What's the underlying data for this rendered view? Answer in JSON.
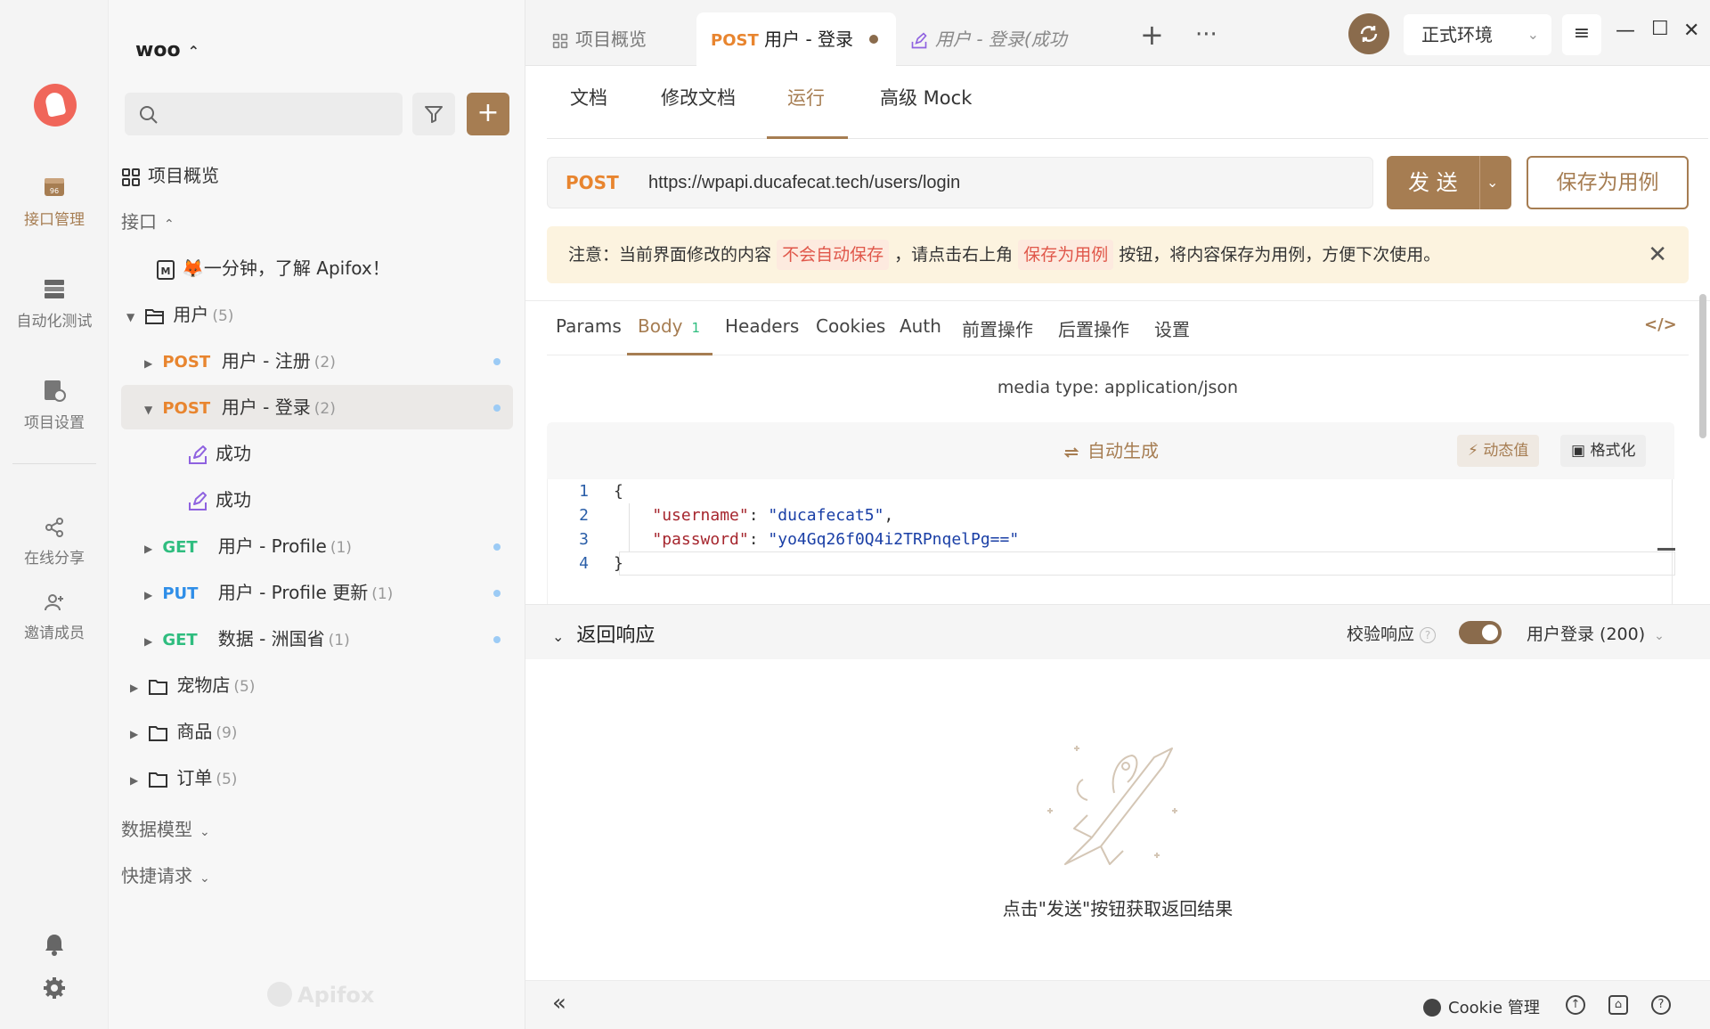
{
  "rail": {
    "items": [
      {
        "label": "接口管理",
        "icon": "api-icon",
        "active": true
      },
      {
        "label": "自动化测试",
        "icon": "test-icon",
        "active": false
      },
      {
        "label": "项目设置",
        "icon": "settings-doc-icon",
        "active": false
      },
      {
        "label": "在线分享",
        "icon": "share-icon",
        "active": false
      },
      {
        "label": "邀请成员",
        "icon": "invite-icon",
        "active": false
      }
    ]
  },
  "sidebar": {
    "project_name": "woo",
    "search_placeholder": "",
    "overview": "项目概览",
    "api_section": "接口",
    "intro": "🦊一分钟，了解 Apifox！",
    "folder_user": {
      "name": "用户",
      "count": "(5)"
    },
    "items": [
      {
        "method": "POST",
        "name": "用户 - 注册",
        "count": "(2)"
      },
      {
        "method": "POST",
        "name": "用户 - 登录",
        "count": "(2)"
      },
      {
        "method": "GET",
        "name": "用户 - Profile",
        "count": "(1)"
      },
      {
        "method": "PUT",
        "name": "用户 - Profile 更新",
        "count": "(1)"
      },
      {
        "method": "GET",
        "name": "数据 - 洲国省",
        "count": "(1)"
      }
    ],
    "cases": [
      "成功",
      "成功"
    ],
    "folders": [
      {
        "name": "宠物店",
        "count": "(5)"
      },
      {
        "name": "商品",
        "count": "(9)"
      },
      {
        "name": "订单",
        "count": "(5)"
      }
    ],
    "data_models": "数据模型",
    "quick_requests": "快捷请求",
    "watermark": "Apifox"
  },
  "tabs": {
    "overview": "项目概览",
    "active_method": "POST",
    "active_name": "用户 - 登录",
    "case_tab": "用户 - 登录(成功",
    "env": "正式环境"
  },
  "subtabs": [
    "文档",
    "修改文档",
    "运行",
    "高级 Mock"
  ],
  "request": {
    "method": "POST",
    "url": "https://wpapi.ducafecat.tech/users/login",
    "send": "发 送",
    "save_case": "保存为用例"
  },
  "notice": {
    "prefix": "注意：当前界面修改的内容",
    "hl1": "不会自动保存",
    "mid": "，请点击右上角",
    "hl2": "保存为用例",
    "suffix": "按钮，将内容保存为用例，方便下次使用。"
  },
  "param_tabs": {
    "params": "Params",
    "body": "Body",
    "body_badge": "1",
    "headers": "Headers",
    "cookies": "Cookies",
    "auth": "Auth",
    "pre": "前置操作",
    "post": "后置操作",
    "settings": "设置"
  },
  "body": {
    "media_type": "media type: application/json",
    "auto_generate": "自动生成",
    "dynamic_value": "动态值",
    "format": "格式化",
    "lines": [
      {
        "n": "1",
        "text": "{"
      },
      {
        "n": "2",
        "key": "\"username\"",
        "val": "\"ducafecat5\"",
        "trail": ","
      },
      {
        "n": "3",
        "key": "\"password\"",
        "val": "\"yo4Gq26f0Q4i2TRPnqelPg==\"",
        "trail": ""
      },
      {
        "n": "4",
        "text": "}"
      }
    ]
  },
  "response": {
    "title": "返回响应",
    "verify": "校验响应",
    "case": "用户登录 (200)",
    "empty": "点击\"发送\"按钮获取返回结果"
  },
  "statusbar": {
    "cookie": "Cookie 管理"
  },
  "colors": {
    "accent": "#a67d52",
    "post": "#e8852f",
    "get": "#2fbd7f",
    "put": "#2f8ee8"
  }
}
